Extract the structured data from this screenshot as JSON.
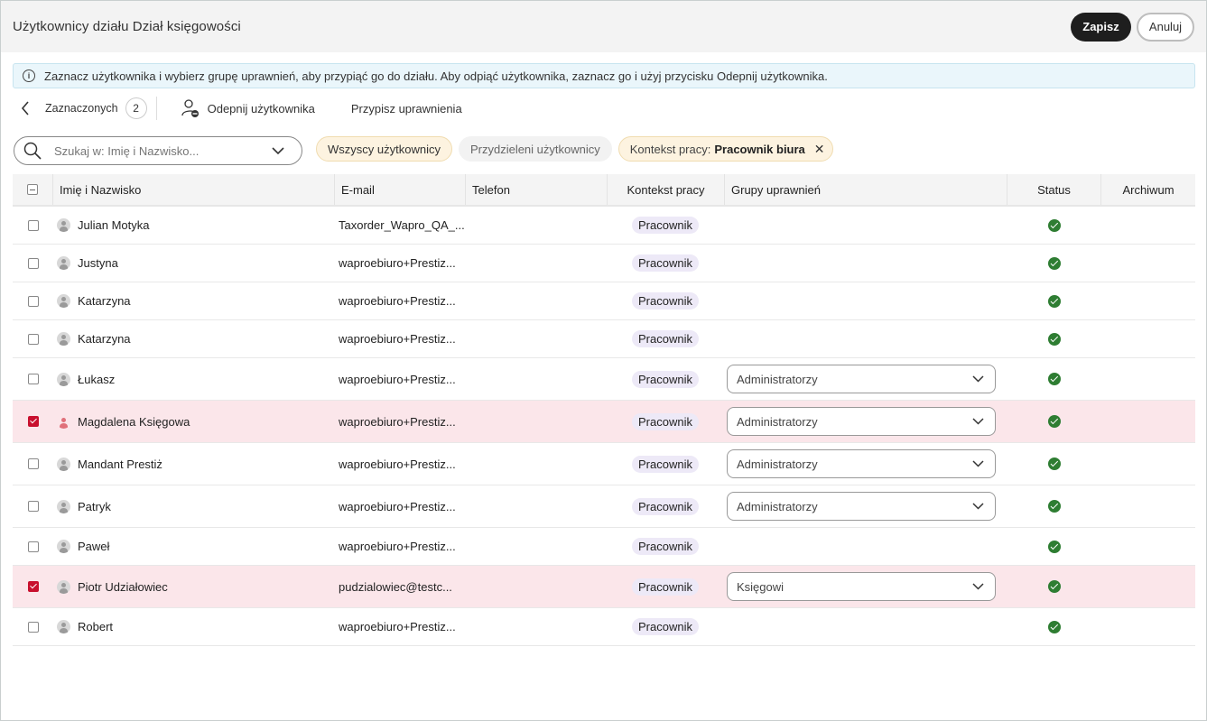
{
  "dialog": {
    "title": "Użytkownicy działu Dział księgowości",
    "save_label": "Zapisz",
    "cancel_label": "Anuluj"
  },
  "info_text": "Zaznacz użytkownika i wybierz grupę uprawnień, aby przypiąć go do działu. Aby odpiąć użytkownika, zaznacz go i użyj przycisku Odepnij użytkownika.",
  "toolbar": {
    "selected_label": "Zaznaczonych",
    "selected_count": "2",
    "unpin_label": "Odepnij użytkownika",
    "assign_label": "Przypisz uprawnienia"
  },
  "search": {
    "placeholder": "Szukaj w: Imię i Nazwisko..."
  },
  "filters": {
    "all_users": "Wszyscy użytkownicy",
    "assigned_users": "Przydzieleni użytkownicy",
    "context_prefix": "Kontekst pracy:",
    "context_value": "Pracownik biura"
  },
  "columns": {
    "name": "Imię i Nazwisko",
    "email": "E-mail",
    "phone": "Telefon",
    "context": "Kontekst pracy",
    "groups": "Grupy uprawnień",
    "status": "Status",
    "archive": "Archiwum"
  },
  "rows": [
    {
      "name": "Julian Motyka",
      "email": "Taxorder_Wapro_QA_...",
      "context": "Pracownik",
      "group": null,
      "checked": false
    },
    {
      "name": "Justyna",
      "email": "waproebiuro+Prestiz...",
      "context": "Pracownik",
      "group": null,
      "checked": false
    },
    {
      "name": "Katarzyna",
      "email": "waproebiuro+Prestiz...",
      "context": "Pracownik",
      "group": null,
      "checked": false
    },
    {
      "name": "Katarzyna",
      "email": "waproebiuro+Prestiz...",
      "context": "Pracownik",
      "group": null,
      "checked": false
    },
    {
      "name": "Łukasz",
      "email": "waproebiuro+Prestiz...",
      "context": "Pracownik",
      "group": "Administratorzy",
      "checked": false
    },
    {
      "name": "Magdalena Księgowa",
      "email": "waproebiuro+Prestiz...",
      "context": "Pracownik",
      "group": "Administratorzy",
      "checked": true
    },
    {
      "name": "Mandant Prestiż",
      "email": "waproebiuro+Prestiz...",
      "context": "Pracownik",
      "group": "Administratorzy",
      "checked": false
    },
    {
      "name": "Patryk",
      "email": "waproebiuro+Prestiz...",
      "context": "Pracownik",
      "group": "Administratorzy",
      "checked": false
    },
    {
      "name": "Paweł",
      "email": "waproebiuro+Prestiz...",
      "context": "Pracownik",
      "group": null,
      "checked": false
    },
    {
      "name": "Piotr Udziałowiec",
      "email": "pudzialowiec@testc...",
      "context": "Pracownik",
      "group": "Księgowi",
      "checked": true
    },
    {
      "name": "Robert",
      "email": "waproebiuro+Prestiz...",
      "context": "Pracownik",
      "group": null,
      "checked": false
    }
  ],
  "colors": {
    "selected_row": "#fbe6ea",
    "checkbox_checked": "#c8102e",
    "status_ok": "#2e7d32",
    "badge_bg": "#ede9f7"
  }
}
